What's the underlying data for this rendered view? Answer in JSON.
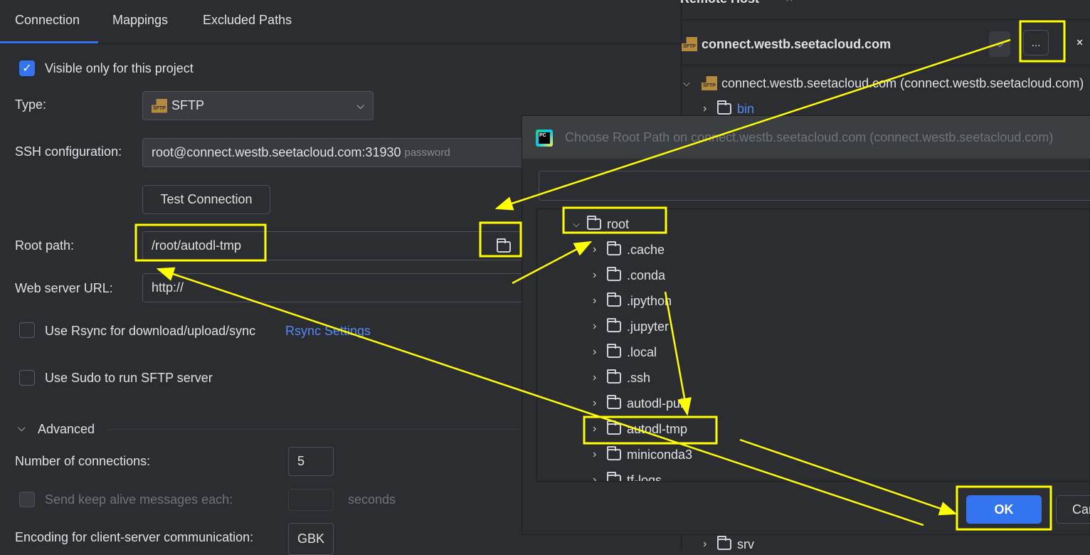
{
  "settings": {
    "tabs": [
      "Connection",
      "Mappings",
      "Excluded Paths"
    ],
    "visible_only": {
      "label": "Visible only for this project",
      "checked": true
    },
    "type": {
      "label": "Type:",
      "value": "SFTP",
      "icon": "sftp-icon"
    },
    "ssh": {
      "label": "SSH configuration:",
      "value": "root@connect.westb.seetacloud.com:31930",
      "hint": "password"
    },
    "test_connection": "Test Connection",
    "root_path": {
      "label": "Root path:",
      "value": "/root/autodl-tmp"
    },
    "web_url": {
      "label": "Web server URL:",
      "value": "http://"
    },
    "rsync": {
      "label": "Use Rsync for download/upload/sync",
      "link": "Rsync Settings",
      "checked": false
    },
    "sudo": {
      "label": "Use Sudo to run SFTP server",
      "checked": false
    },
    "advanced": {
      "label": "Advanced"
    },
    "connections": {
      "label": "Number of connections:",
      "value": "5"
    },
    "keepalive": {
      "label": "Send keep alive messages each:",
      "value": "",
      "unit": "seconds"
    },
    "encoding": {
      "label": "Encoding for client-server communication:",
      "value": "GBK"
    }
  },
  "remote": {
    "title": "Remote Host",
    "server": "connect.westb.seetacloud.com",
    "more_button": "...",
    "root_node": "connect.westb.seetacloud.com (connect.westb.seetacloud.com)",
    "items": [
      "bin",
      "srv"
    ]
  },
  "dialog": {
    "title": "Choose Root Path on connect.westb.seetacloud.com (connect.westb.seetacloud.com)",
    "search_value": "",
    "root": "root",
    "children": [
      ".cache",
      ".conda",
      ".ipython",
      ".jupyter",
      ".local",
      ".ssh",
      "autodl-pub",
      "autodl-tmp",
      "miniconda3",
      "tf-logs"
    ],
    "ok": "OK",
    "cancel": "Cancel"
  },
  "colors": {
    "accent": "#3574f0",
    "annotation": "#ffff00",
    "link": "#548af7"
  }
}
